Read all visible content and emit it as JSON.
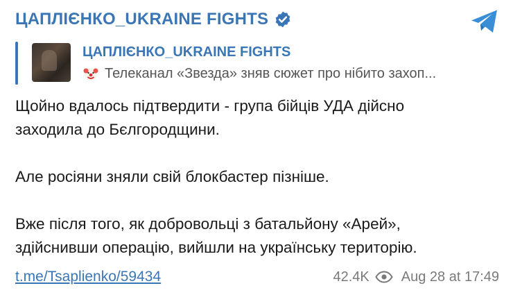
{
  "header": {
    "channel_name": "ЦАПЛІЄНКО_UKRAINE FIGHTS",
    "verified_icon": "verified-badge-icon",
    "app_icon": "telegram-logo-icon"
  },
  "reply": {
    "channel_name": "ЦАПЛІЄНКО_UKRAINE FIGHTS",
    "emoji_icon": "clown-face-icon",
    "preview_text": "Телеканал «Звезда» зняв сюжет про нібито захоп..."
  },
  "message": {
    "line1": "Щойно вдалось підтвердити - група бійців УДА дійсно",
    "line2": "заходила до Бєлгородщини.",
    "line3": "Але росіяни зняли свій блокбастер пізніше.",
    "line4": "Вже після того, як добровольці з батальйону «Арей»,",
    "line5": "здійснивши операцію, вийшли на українську територію."
  },
  "footer": {
    "link": "t.me/Tsaplienko/59434",
    "views": "42.4K",
    "views_icon": "eye-icon",
    "datetime": "Aug 28 at 17:49"
  },
  "colors": {
    "accent": "#3a76b6",
    "muted": "#7a7a7a",
    "text": "#1a1a1a"
  }
}
